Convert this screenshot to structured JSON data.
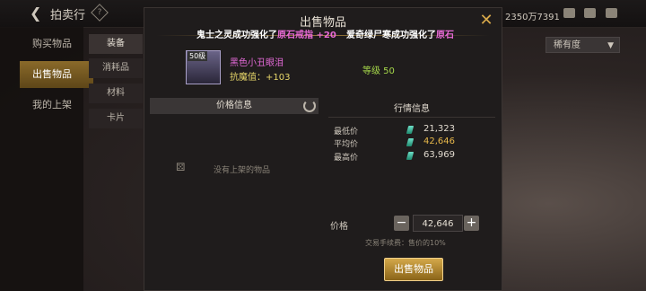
{
  "header": {
    "title": "拍卖行",
    "currency_text": "2350万7391"
  },
  "left_nav": {
    "items": [
      {
        "label": "购买物品"
      },
      {
        "label": "出售物品"
      },
      {
        "label": "我的上架"
      }
    ]
  },
  "sub_nav": {
    "items": [
      {
        "label": "装备"
      },
      {
        "label": "消耗品"
      },
      {
        "label": "材料"
      },
      {
        "label": "卡片"
      }
    ]
  },
  "sort_select": {
    "value": "稀有度"
  },
  "modal": {
    "title": "出售物品",
    "notice_1": {
      "a": "鬼士之灵成功强化了",
      "b": "原石戒指",
      "c": " +20"
    },
    "notice_2": {
      "a": "爱奇绿尸寒成功强化了",
      "b": "原石"
    },
    "item": {
      "level_badge": "50级",
      "name": "黑色小丑眼泪",
      "stat": "抗魔值：+103",
      "level_text": "等级 50"
    },
    "price_info_title": "价格信息",
    "empty_text": "没有上架的物品",
    "market": {
      "title": "行情信息",
      "rows": [
        {
          "label": "最低价",
          "value": "21,323"
        },
        {
          "label": "平均价",
          "value": "42,646"
        },
        {
          "label": "最高价",
          "value": "63,969"
        }
      ]
    },
    "price_label": "价格",
    "price_value": "42,646",
    "fee_text": "交易手续费：售价的10%",
    "sell_button": "出售物品"
  },
  "colors": {
    "accent": "#d4a84a",
    "highlight": "#e86ad6",
    "level_green": "#a6d84a"
  }
}
